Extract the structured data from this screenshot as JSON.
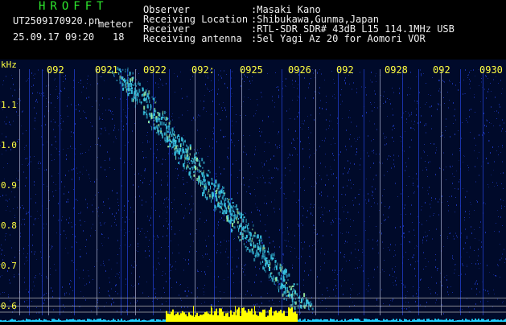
{
  "header": {
    "brand": "HROFFT",
    "file_name": "UT2509170920.pn",
    "file_suffix": "meteor",
    "timestamp": "25.09.17 09:20",
    "count": "18",
    "fields": [
      {
        "label": "Observer",
        "value": ":Masaki Kano"
      },
      {
        "label": "Receiving Location",
        "value": ":Shibukawa,Gunma,Japan"
      },
      {
        "label": "Receiver",
        "value": ":RTL-SDR SDR# 43dB L15 114.1MHz USB"
      },
      {
        "label": "Receiving antenna",
        "value": ":5el Yagi Az 20 for Aomori VOR"
      }
    ]
  },
  "spectrogram": {
    "y_unit": "kHz",
    "y_ticks": [
      {
        "value": 1.1,
        "label": "1.1"
      },
      {
        "value": 1.0,
        "label": "1.0"
      },
      {
        "value": 0.9,
        "label": "0.9"
      },
      {
        "value": 0.8,
        "label": "0.8"
      },
      {
        "value": 0.7,
        "label": "0.7"
      },
      {
        "value": 0.6,
        "label": "0.6"
      }
    ],
    "x_ticks": [
      "092",
      "0921",
      "0922",
      "092:",
      "0925",
      "0926",
      "092",
      "0928",
      "092",
      "0930"
    ],
    "colors": {
      "background": "#000a2a",
      "noise": "#1f3cc8",
      "trail": "#39c8e6",
      "trail_hot": "#9ef0a0",
      "marker": "#ffff00",
      "floor": "#20d0ff",
      "grid": "#b0b0b0",
      "label": "#ffff40"
    }
  }
}
